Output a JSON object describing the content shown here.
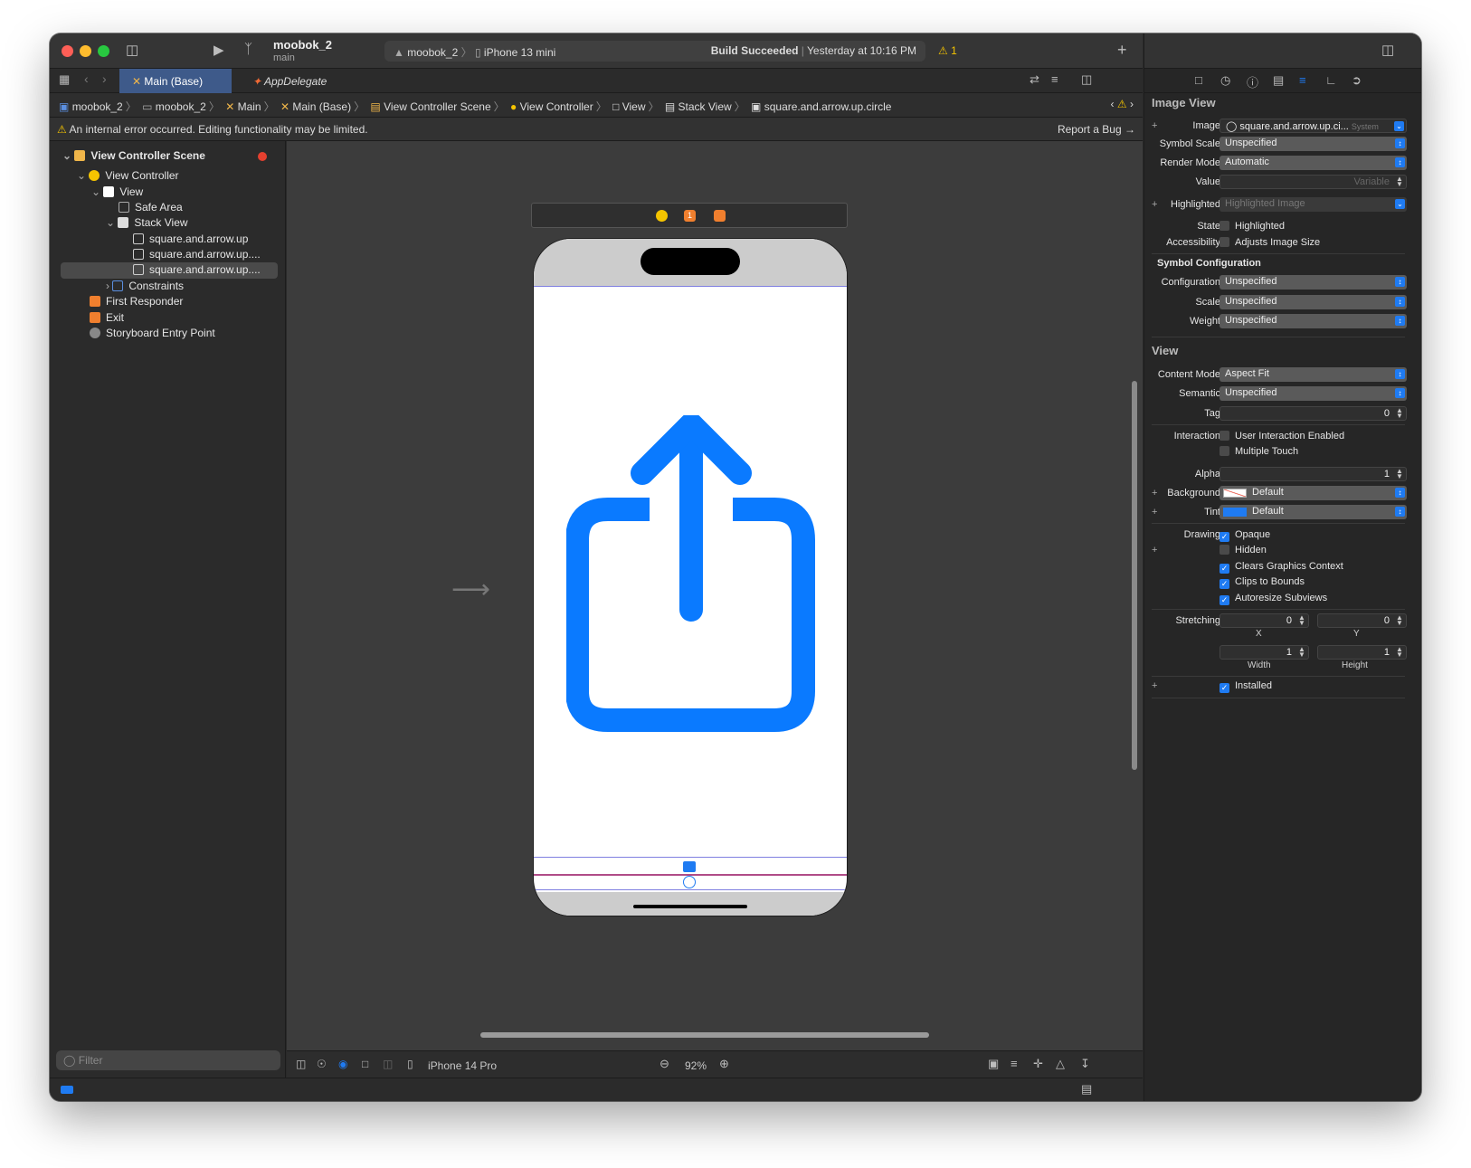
{
  "project": {
    "name": "moobok_2",
    "branch": "main"
  },
  "scheme": {
    "target": "moobok_2",
    "device": "iPhone 13 mini",
    "status_bold": "Build Succeeded",
    "status_rest": "Yesterday at 10:16 PM",
    "warning_count": "1"
  },
  "tabs": [
    {
      "label": "Main (Base)"
    },
    {
      "label": "AppDelegate"
    }
  ],
  "breadcrumb": [
    "moobok_2",
    "moobok_2",
    "Main",
    "Main (Base)",
    "View Controller Scene",
    "View Controller",
    "View",
    "Stack View",
    "square.and.arrow.up.circle"
  ],
  "error_bar": {
    "message": "An internal error occurred. Editing functionality may be limited.",
    "report": "Report a Bug"
  },
  "navigator": {
    "items": [
      {
        "label": "View Controller Scene"
      },
      {
        "label": "View Controller"
      },
      {
        "label": "View"
      },
      {
        "label": "Safe Area"
      },
      {
        "label": "Stack View"
      },
      {
        "label": "square.and.arrow.up"
      },
      {
        "label": "square.and.arrow.up...."
      },
      {
        "label": "square.and.arrow.up...."
      },
      {
        "label": "Constraints"
      },
      {
        "label": "First Responder"
      },
      {
        "label": "Exit"
      },
      {
        "label": "Storyboard Entry Point"
      }
    ],
    "filter_placeholder": "Filter"
  },
  "canvas": {
    "device": "iPhone 14 Pro",
    "zoom": "92%",
    "first_responder_badge": "1"
  },
  "inspector": {
    "image_view": {
      "title": "Image View",
      "image_label": "Image",
      "image_value": "square.and.arrow.up.ci...",
      "image_source": "System",
      "symbol_scale_label": "Symbol Scale",
      "symbol_scale": "Unspecified",
      "render_mode_label": "Render Mode",
      "render_mode": "Automatic",
      "value_label": "Value",
      "value_placeholder": "Variable",
      "highlighted_label": "Highlighted",
      "highlighted_placeholder": "Highlighted Image",
      "state_label": "State",
      "state_option": "Highlighted",
      "accessibility_label": "Accessibility",
      "accessibility_option": "Adjusts Image Size"
    },
    "symbol_config": {
      "title": "Symbol Configuration",
      "configuration_label": "Configuration",
      "configuration": "Unspecified",
      "scale_label": "Scale",
      "scale": "Unspecified",
      "weight_label": "Weight",
      "weight": "Unspecified"
    },
    "view": {
      "title": "View",
      "content_mode_label": "Content Mode",
      "content_mode": "Aspect Fit",
      "semantic_label": "Semantic",
      "semantic": "Unspecified",
      "tag_label": "Tag",
      "tag": "0",
      "interaction_label": "Interaction",
      "user_interaction": "User Interaction Enabled",
      "multiple_touch": "Multiple Touch",
      "alpha_label": "Alpha",
      "alpha": "1",
      "background_label": "Background",
      "background": "Default",
      "tint_label": "Tint",
      "tint": "Default",
      "drawing_label": "Drawing",
      "opaque": "Opaque",
      "hidden": "Hidden",
      "clears_context": "Clears Graphics Context",
      "clips_bounds": "Clips to Bounds",
      "autoresize": "Autoresize Subviews",
      "stretching_label": "Stretching",
      "stretch_x": "0",
      "stretch_y": "0",
      "stretch_w": "1",
      "stretch_h": "1",
      "x_label": "X",
      "y_label": "Y",
      "width_label": "Width",
      "height_label": "Height",
      "installed": "Installed"
    }
  },
  "colors": {
    "accent": "#1f7bf2",
    "symbol_blue": "#0a7aff"
  }
}
